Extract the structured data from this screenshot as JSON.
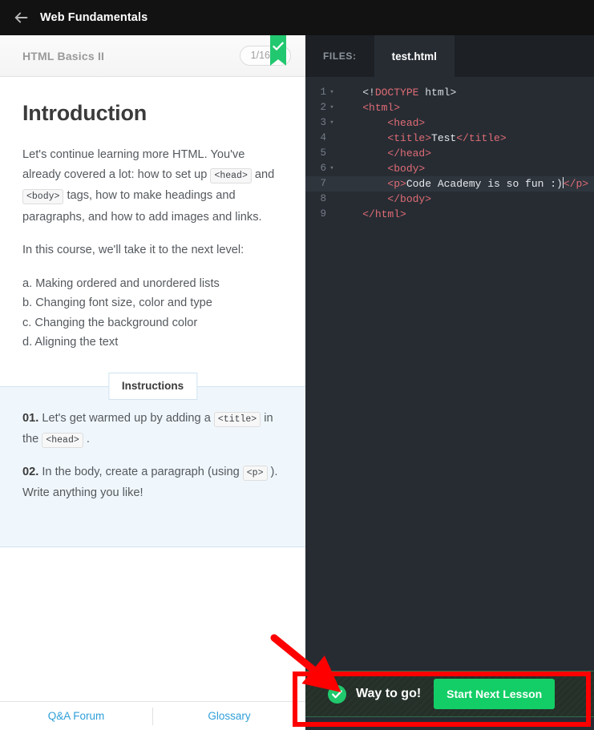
{
  "topbar": {
    "back_icon": "arrow-left-icon",
    "title": "Web Fundamentals"
  },
  "lesson_header": {
    "title": "HTML Basics II",
    "progress": "1/16",
    "completed_icon": "bookmark-check-icon"
  },
  "lesson": {
    "heading": "Introduction",
    "paragraph1_a": "Let's continue learning more HTML. You've already covered a lot: how to set up ",
    "code_head": "<head>",
    "paragraph1_b": " and ",
    "code_body": "<body>",
    "paragraph1_c": " tags, how to make headings and paragraphs, and how to add images and links.",
    "paragraph2": "In this course, we'll take it to the next level:",
    "list": [
      "a. Making ordered and unordered lists",
      "b. Changing font size, color and type",
      "c. Changing the background color",
      "d. Aligning the text"
    ]
  },
  "instructions": {
    "tab_label": "Instructions",
    "item1_num": "01.",
    "item1_a": " Let's get warmed up by adding a ",
    "item1_code1": "<title>",
    "item1_b": " in the ",
    "item1_code2": "<head>",
    "item1_c": " .",
    "item2_num": "02.",
    "item2_a": " In the body, create a paragraph (using ",
    "item2_code1": "<p>",
    "item2_b": " ). Write anything you like!"
  },
  "left_footer": {
    "qa_forum": "Q&A Forum",
    "glossary": "Glossary"
  },
  "editor": {
    "files_label": "FILES:",
    "active_tab": "test.html",
    "active_line": 7,
    "lines": [
      {
        "n": "1",
        "fold": true,
        "indent": 0,
        "segments": [
          {
            "t": "<!",
            "c": "punct"
          },
          {
            "t": "DOCTYPE",
            "c": "tag"
          },
          {
            "t": " html>",
            "c": "punct"
          }
        ]
      },
      {
        "n": "2",
        "fold": true,
        "indent": 0,
        "segments": [
          {
            "t": "<html>",
            "c": "tag"
          }
        ]
      },
      {
        "n": "3",
        "fold": true,
        "indent": 1,
        "segments": [
          {
            "t": "<head>",
            "c": "tag"
          }
        ]
      },
      {
        "n": "4",
        "fold": false,
        "indent": 1,
        "segments": [
          {
            "t": "<title>",
            "c": "tag"
          },
          {
            "t": "Test",
            "c": "txt"
          },
          {
            "t": "</title>",
            "c": "tag"
          }
        ]
      },
      {
        "n": "5",
        "fold": false,
        "indent": 1,
        "segments": [
          {
            "t": "</head>",
            "c": "tag"
          }
        ]
      },
      {
        "n": "6",
        "fold": true,
        "indent": 1,
        "segments": [
          {
            "t": "<body>",
            "c": "tag"
          }
        ]
      },
      {
        "n": "7",
        "fold": false,
        "indent": 1,
        "segments": [
          {
            "t": "<p>",
            "c": "tag"
          },
          {
            "t": "Code Academy is so fun :)",
            "c": "txt"
          },
          {
            "t": "CURSOR",
            "c": "cursor"
          },
          {
            "t": "</p>",
            "c": "tag"
          }
        ]
      },
      {
        "n": "8",
        "fold": false,
        "indent": 1,
        "segments": [
          {
            "t": "</body>",
            "c": "tag"
          }
        ]
      },
      {
        "n": "9",
        "fold": false,
        "indent": 0,
        "segments": [
          {
            "t": "</html>",
            "c": "tag"
          }
        ]
      }
    ]
  },
  "banner": {
    "check_icon": "check-circle-icon",
    "message": "Way to go!",
    "next_button": "Start Next Lesson"
  },
  "annotation": {
    "highlight_color": "#ff0000",
    "arrow_icon": "red-arrow-icon"
  },
  "colors": {
    "accent_green": "#13ce66",
    "link_blue": "#2f9fd9",
    "editor_bg": "#272c33",
    "instructions_bg": "#f0f7fc"
  }
}
